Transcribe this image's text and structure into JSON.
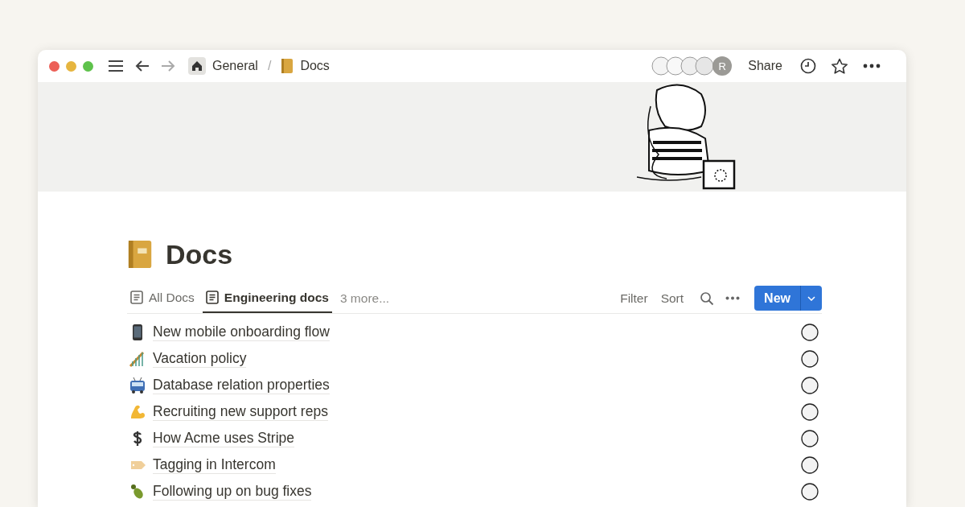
{
  "breadcrumbs": [
    {
      "label": "General"
    },
    {
      "label": "Docs"
    }
  ],
  "breadcrumb_separator": "/",
  "topbar": {
    "avatar_initial": "R",
    "share": "Share"
  },
  "page": {
    "title": "Docs"
  },
  "views": [
    {
      "label": "All Docs",
      "selected": false
    },
    {
      "label": "Engineering docs",
      "selected": true
    }
  ],
  "more_views": "3 more...",
  "actions": [
    "Filter",
    "Sort"
  ],
  "new_button": "New",
  "rows": [
    {
      "title": "New mobile onboarding flow"
    },
    {
      "title": "Vacation policy"
    },
    {
      "title": "Database relation properties"
    },
    {
      "title": "Recruiting new support reps"
    },
    {
      "title": "How Acme uses Stripe"
    },
    {
      "title": "Tagging in Intercom"
    },
    {
      "title": "Following up on bug fixes"
    }
  ]
}
